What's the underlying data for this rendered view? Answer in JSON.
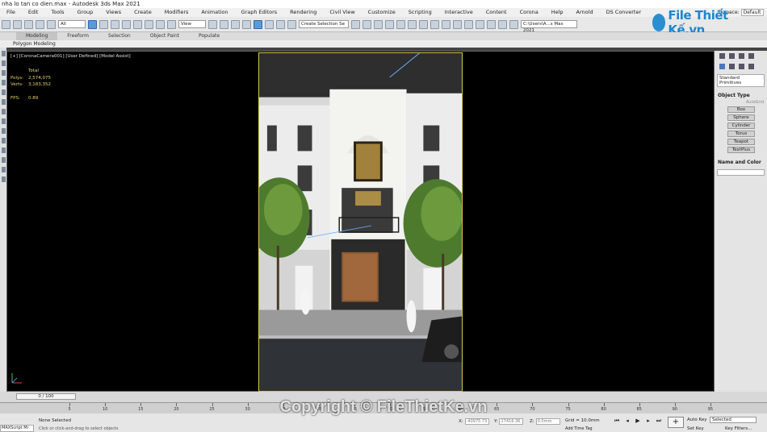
{
  "window": {
    "title": "nha lo tan co dien.max - Autodesk 3ds Max 2021"
  },
  "menu": {
    "items": [
      "File",
      "Edit",
      "Tools",
      "Group",
      "Views",
      "Create",
      "Modifiers",
      "Animation",
      "Graph Editors",
      "Rendering",
      "Civil View",
      "Customize",
      "Scripting",
      "Interactive",
      "Content",
      "Corona",
      "Help",
      "Arnold",
      "DS Converter"
    ],
    "workspace_label": "rkspace:",
    "workspace_value": "Default"
  },
  "toolbar": {
    "filter_value": "All",
    "ref_coord_value": "View",
    "selection_set_placeholder": "Create Selection Se",
    "project_path": "C:\\Users\\A...s Max 2021"
  },
  "ribbon": {
    "tabs": [
      "Modeling",
      "Freeform",
      "Selection",
      "Object Paint",
      "Populate"
    ],
    "active_tab": "Modeling",
    "sub_label": "Polygon Modeling"
  },
  "viewport": {
    "label": "[+] [CoronaCamera001] [User Defined] [Model Assist]",
    "stats": {
      "total_label": "Total",
      "polys_label": "Polys:",
      "polys_value": "2,574,075",
      "verts_label": "Verts:",
      "verts_value": "3,183,352",
      "fps_label": "FPS:",
      "fps_value": "0.89"
    }
  },
  "command_panel": {
    "category": "Standard Primitives",
    "object_type_title": "Object Type",
    "autogrid_label": "AutoGrid",
    "buttons": [
      "Box",
      "Sphere",
      "Cylinder",
      "Torus",
      "Teapot",
      "TextPlus"
    ],
    "name_color_title": "Name and Color"
  },
  "timeline": {
    "frame_counter": "0 / 100",
    "ticks": [
      "5",
      "10",
      "15",
      "20",
      "25",
      "30",
      "35",
      "40",
      "45",
      "50",
      "55",
      "60",
      "65",
      "70",
      "75",
      "80",
      "85",
      "90",
      "95"
    ]
  },
  "status": {
    "maxscript": "MAXScript Mi",
    "selection": "None Selected",
    "hint": "Click or click-and-drag to select objects",
    "x_label": "X:",
    "x_value": "-40975.73",
    "y_label": "Y:",
    "y_value": "17416.36",
    "z_label": "Z:",
    "z_value": "0.0mm",
    "grid": "Grid = 10.0mm",
    "auto_key": "Auto Key",
    "set_key": "Set Key",
    "selected_value": "Selected",
    "key_filters": "Key Filters...",
    "add_time_tag": "Add Time Tag"
  },
  "branding": {
    "logo_text": "File Thiết Kế.vn",
    "watermark": "Copyright © FileThietKe.vn"
  },
  "colors": {
    "accent": "#5b9bd5",
    "stats_text": "#e8d36a",
    "render_frame": "#d8c44a",
    "logo": "#1c87cf"
  }
}
